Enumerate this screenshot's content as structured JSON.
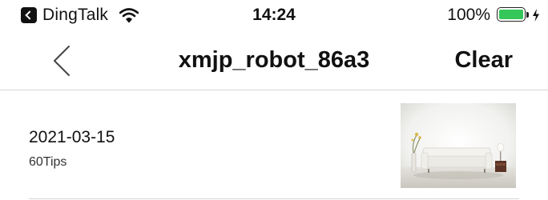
{
  "status_bar": {
    "app_label": "DingTalk",
    "time": "14:24",
    "battery_pct": "100%",
    "icons": [
      "back-to-app-icon",
      "wifi-icon",
      "battery-icon",
      "charging-icon"
    ]
  },
  "nav": {
    "back_icon": "chevron-left-icon",
    "title": "xmjp_robot_86a3",
    "clear_label": "Clear"
  },
  "list": {
    "items": [
      {
        "date": "2021-03-15",
        "subtitle": "60Tips",
        "thumbnail": "room-sofa-thumbnail"
      }
    ]
  },
  "colors": {
    "battery": "#35c759",
    "divider": "#d6d6d6",
    "text": "#111111"
  }
}
